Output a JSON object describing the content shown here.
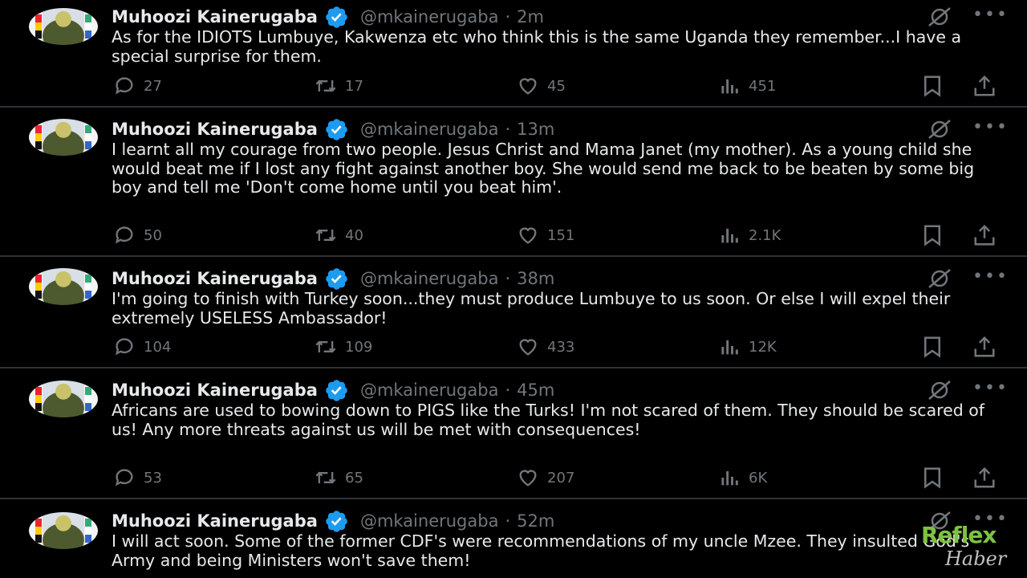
{
  "tweets": [
    {
      "name": "Muhoozi Kainerugaba",
      "handle": "@mkainerugaba",
      "time": "2m",
      "text": "As for the IDIOTS Lumbuye, Kakwenza etc who think this is the same Uganda they remember...I have a special surprise for them.",
      "replies": "27",
      "retweets": "17",
      "likes": "45",
      "views": "451"
    },
    {
      "name": "Muhoozi Kainerugaba",
      "handle": "@mkainerugaba",
      "time": "13m",
      "text": "I learnt all my courage from two people. Jesus Christ and Mama Janet (my mother). As a young child she would beat me if I lost any fight against another boy. She would send me back to be beaten by some big boy and tell me 'Don't come home until you beat him'.",
      "replies": "50",
      "retweets": "40",
      "likes": "151",
      "views": "2.1K"
    },
    {
      "name": "Muhoozi Kainerugaba",
      "handle": "@mkainerugaba",
      "time": "38m",
      "text": "I'm going to finish with Turkey soon...they must produce Lumbuye to us soon. Or else I will expel their extremely USELESS Ambassador!",
      "replies": "104",
      "retweets": "109",
      "likes": "433",
      "views": "12K"
    },
    {
      "name": "Muhoozi Kainerugaba",
      "handle": "@mkainerugaba",
      "time": "45m",
      "text": "Africans are used to bowing down to PIGS like the Turks! I'm not scared of them. They should be scared of us! Any more threats against us will be met with consequences!",
      "replies": "53",
      "retweets": "65",
      "likes": "207",
      "views": "6K"
    },
    {
      "name": "Muhoozi Kainerugaba",
      "handle": "@mkainerugaba",
      "time": "52m",
      "text": "I will act soon. Some of the former CDF's were recommendations of my uncle Mzee. They insulted God's Army and being Ministers won't save them!",
      "replies": "",
      "retweets": "",
      "likes": "",
      "views": ""
    }
  ],
  "separator": "·",
  "more_glyph": "•••",
  "watermark": {
    "line1": "Reflex",
    "line2": "Haber"
  },
  "colors": {
    "background": "#000000",
    "text": "#e7e9ea",
    "muted": "#71767b",
    "verified": "#1d9bf0",
    "divider": "#2f3336",
    "watermark_green": "#7dc242"
  },
  "icons": [
    "avatar",
    "verified-badge-icon",
    "grok-icon",
    "more-icon",
    "reply-icon",
    "retweet-icon",
    "like-icon",
    "views-icon",
    "bookmark-icon",
    "share-icon"
  ]
}
